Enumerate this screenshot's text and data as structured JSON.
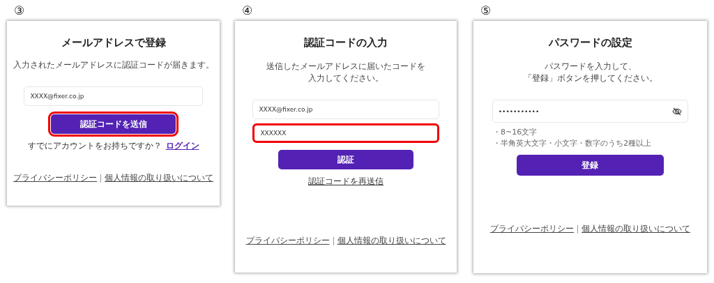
{
  "panels": [
    {
      "step": "③",
      "title": "メールアドレスで登録",
      "description": [
        "入力されたメールアドレスに認証コードが届きます。"
      ],
      "items": [
        {
          "kind": "field",
          "value": "XXXX@fixer.co.jp",
          "highlighted": false
        },
        {
          "kind": "button",
          "label": "認証コードを送信",
          "highlighted": true
        },
        {
          "kind": "prompt",
          "text": "すでにアカウントをお持ちですか？",
          "link": "ログイン"
        }
      ],
      "footer": [
        "プライバシーポリシー",
        "個人情報の取り扱いについて"
      ]
    },
    {
      "step": "④",
      "title": "認証コードの入力",
      "description": [
        "送信したメールアドレスに届いたコードを",
        "入力してください。"
      ],
      "items": [
        {
          "kind": "field",
          "value": "XXXX@fixer.co.jp",
          "highlighted": false
        },
        {
          "kind": "field",
          "value": "XXXXXX",
          "highlighted": true
        },
        {
          "kind": "button",
          "label": "認証",
          "highlighted": false
        },
        {
          "kind": "link",
          "text": "認証コードを再送信"
        }
      ],
      "footer": [
        "プライバシーポリシー",
        "個人情報の取り扱いについて"
      ]
    },
    {
      "step": "⑤",
      "title": "パスワードの設定",
      "description": [
        "パスワードを入力して、",
        "「登録」ボタンを押してください。"
      ],
      "items": [
        {
          "kind": "password",
          "value": "•••••••••••",
          "highlighted": false
        },
        {
          "kind": "hints",
          "lines": [
            "・8~16文字",
            "・半角英大文字・小文字・数字のうち2種以上"
          ]
        },
        {
          "kind": "button",
          "label": "登録",
          "highlighted": false
        }
      ],
      "footer": [
        "プライバシーポリシー",
        "個人情報の取り扱いについて"
      ]
    }
  ]
}
